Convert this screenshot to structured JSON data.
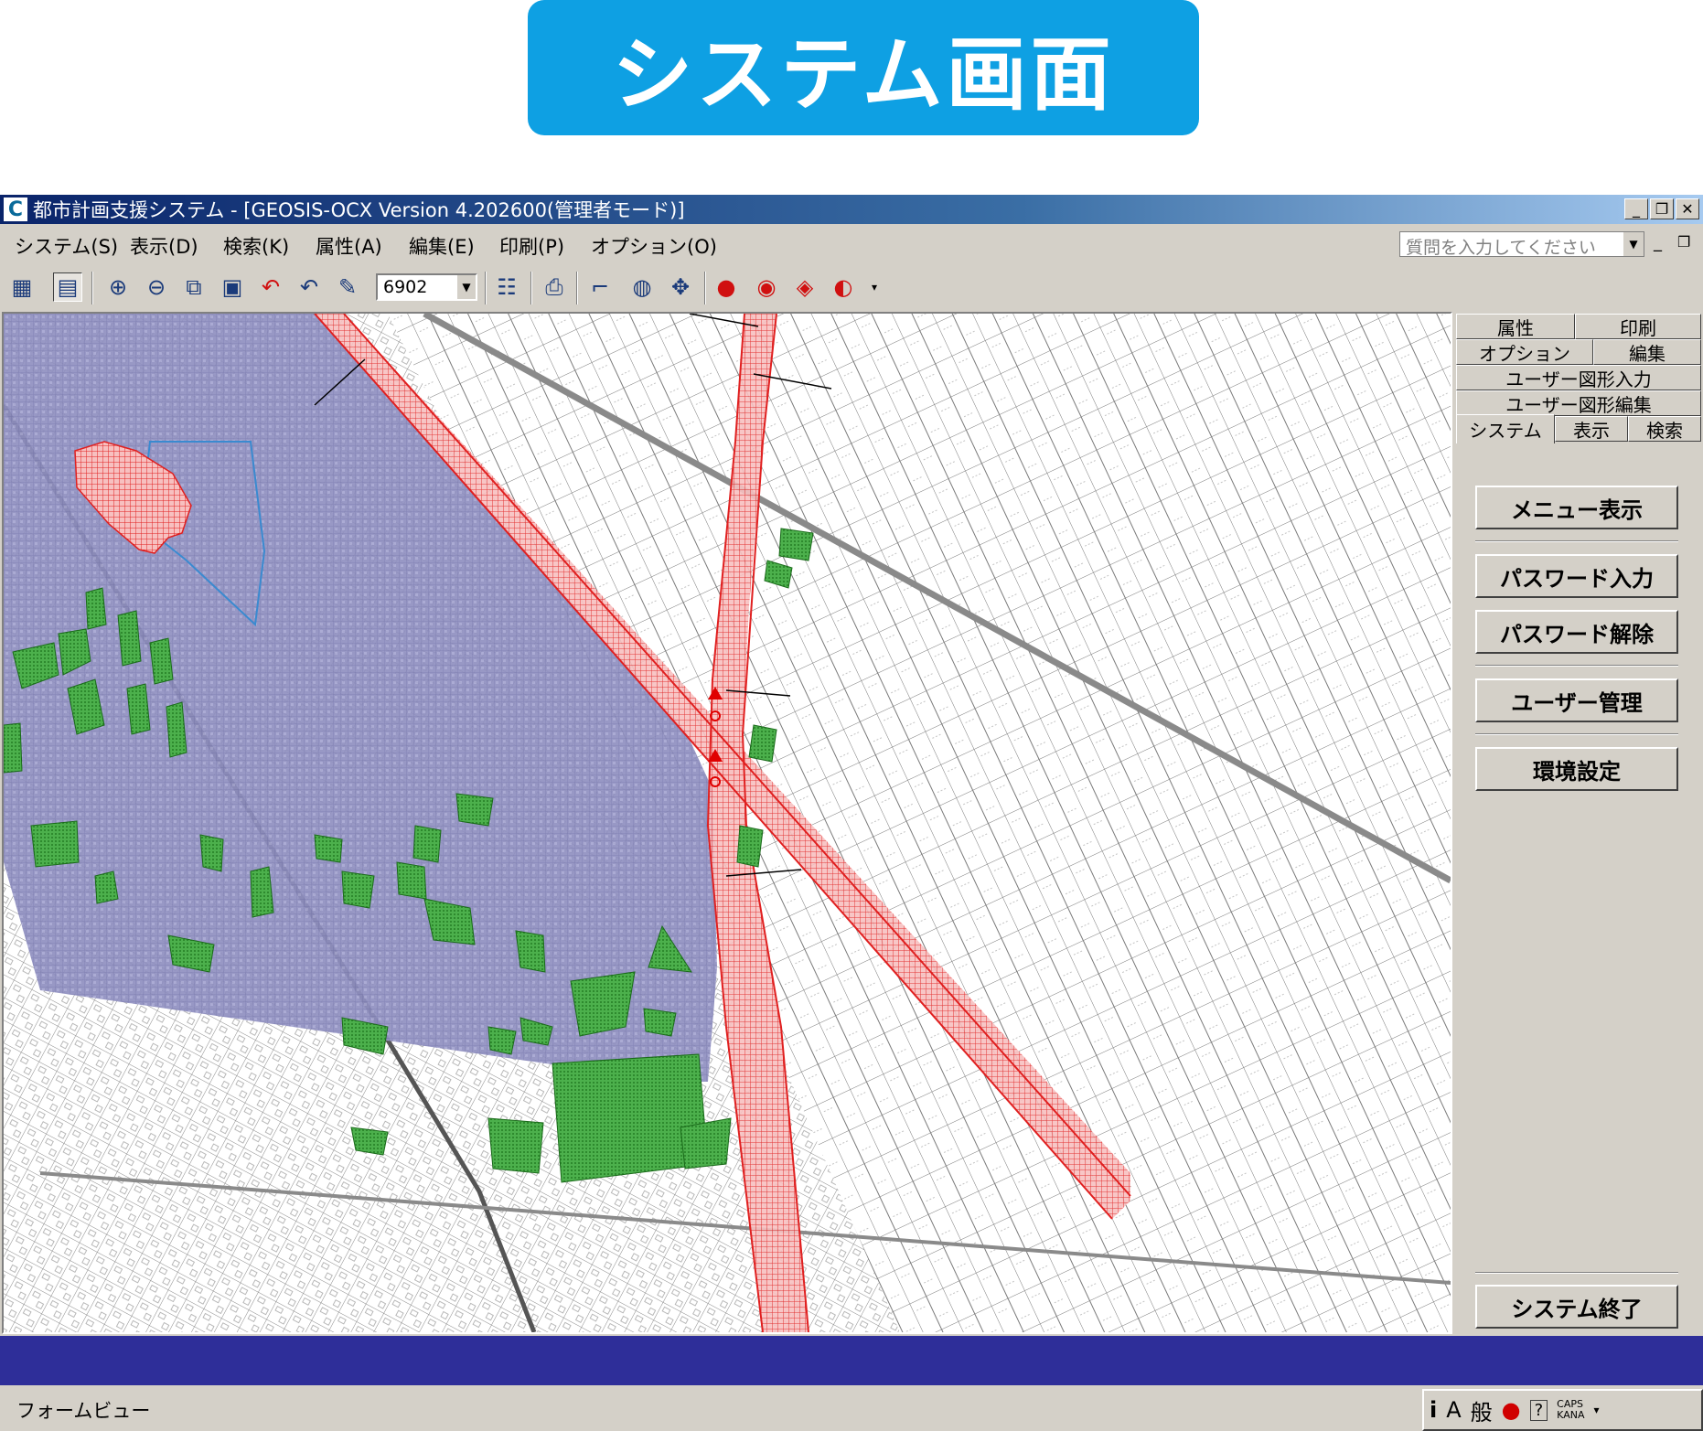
{
  "banner": {
    "title": "システム画面"
  },
  "window": {
    "title": "都市計画支援システム - [GEOSIS-OCX Version 4.202600(管理者モード)]",
    "controls": {
      "minimize": "_",
      "restore": "❐",
      "close": "✕"
    }
  },
  "menubar": {
    "items": [
      "システム(S)",
      "表示(D)",
      "検索(K)",
      "属性(A)",
      "編集(E)",
      "印刷(P)",
      "オプション(O)"
    ],
    "ask_placeholder": "質問を入力してください"
  },
  "toolbar": {
    "scale_value": "6902",
    "icons": [
      "layers-icon",
      "list-view-icon",
      "zoom-in-icon",
      "zoom-out-icon",
      "zoom-window-icon",
      "view-icon",
      "undo-icon",
      "redo-icon",
      "refresh-icon",
      "properties-icon",
      "print-icon",
      "measure-icon",
      "globe-icon",
      "pan-icon",
      "marker-icon",
      "marker-add-icon",
      "marker-edit-icon",
      "marker-delete-icon"
    ]
  },
  "side_panel": {
    "tabs_row1": [
      "属性",
      "印刷"
    ],
    "tabs_row2": [
      "オプション",
      "編集"
    ],
    "tabs_row3": [
      "ユーザー図形入力"
    ],
    "tabs_row4": [
      "ユーザー図形編集"
    ],
    "tabs_row5": [
      "システム",
      "表示",
      "検索"
    ],
    "active_tab": "システム",
    "buttons": [
      "メニュー表示",
      "パスワード入力",
      "パスワード解除",
      "ユーザー管理",
      "環境設定"
    ],
    "exit_button": "システム終了"
  },
  "statusbar": {
    "text": "フォームビュー",
    "ime_mode": "A",
    "ime_kanji": "般",
    "caps": "CAPS",
    "kana": "KANA"
  },
  "colors": {
    "banner": "#0ea0e3",
    "zone_purple": "#8f8fc0",
    "road_red": "#e83a3a",
    "green_area": "#3aa03a",
    "status_blue": "#2e2e99"
  }
}
